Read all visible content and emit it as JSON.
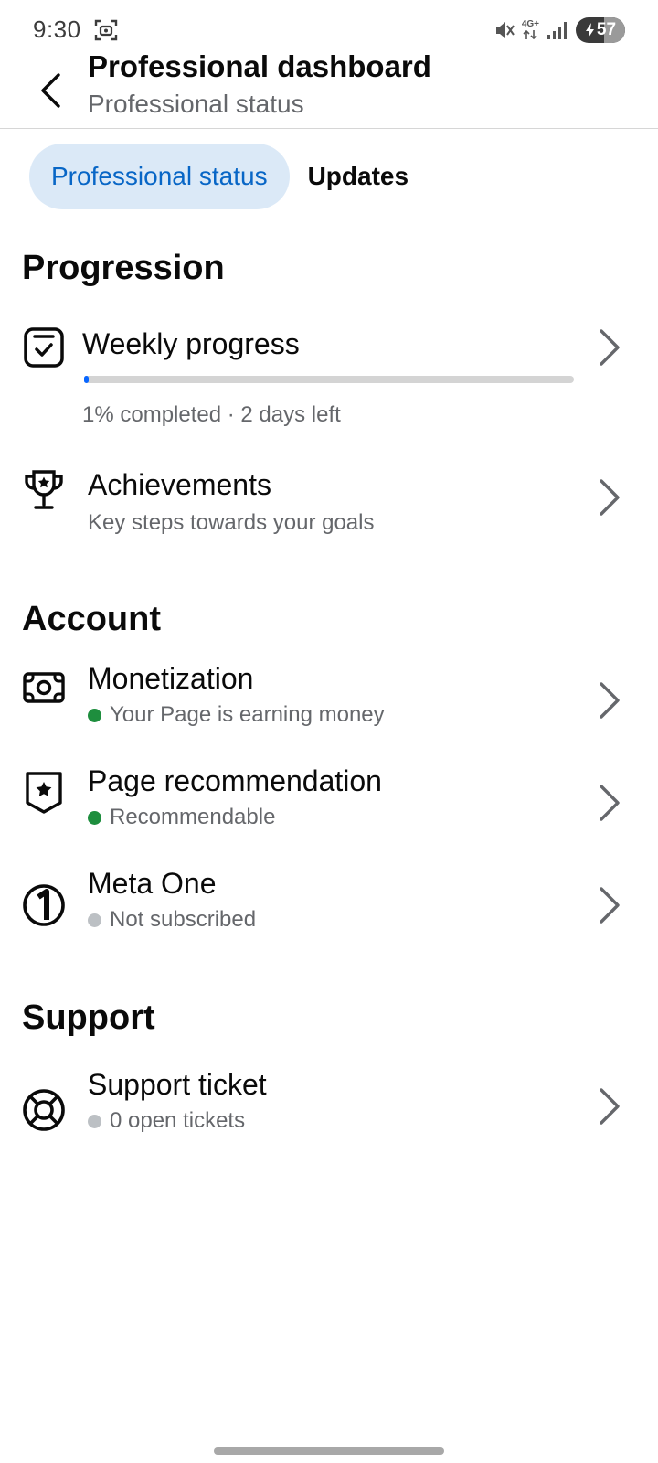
{
  "status": {
    "time": "9:30",
    "network": "4G+",
    "battery": "57",
    "battery_level": 0.57
  },
  "header": {
    "title": "Professional dashboard",
    "subtitle": "Professional status"
  },
  "tabs": [
    {
      "label": "Professional status",
      "active": true
    },
    {
      "label": "Updates",
      "active": false
    }
  ],
  "sections": {
    "progression": {
      "heading": "Progression",
      "weekly": {
        "title": "Weekly progress",
        "progress": 0.01,
        "status": "1% completed · 2 days left"
      },
      "achievements": {
        "title": "Achievements",
        "subtitle": "Key steps towards your goals"
      }
    },
    "account": {
      "heading": "Account",
      "items": [
        {
          "title": "Monetization",
          "status": "Your Page is earning money",
          "dot_color": "#1e8e3e",
          "icon": "money-icon"
        },
        {
          "title": "Page recommendation",
          "status": "Recommendable",
          "dot_color": "#1e8e3e",
          "icon": "shield-star-icon"
        },
        {
          "title": "Meta One",
          "status": "Not subscribed",
          "dot_color": "#bcc0c4",
          "icon": "meta-one-icon"
        }
      ]
    },
    "support": {
      "heading": "Support",
      "ticket": {
        "title": "Support ticket",
        "status": "0 open tickets",
        "dot_color": "#bcc0c4",
        "icon": "lifebuoy-icon"
      }
    }
  },
  "colors": {
    "accent": "#0866c6",
    "tab_active_bg": "#dbe9f7",
    "progress_fill": "#0866ff"
  }
}
